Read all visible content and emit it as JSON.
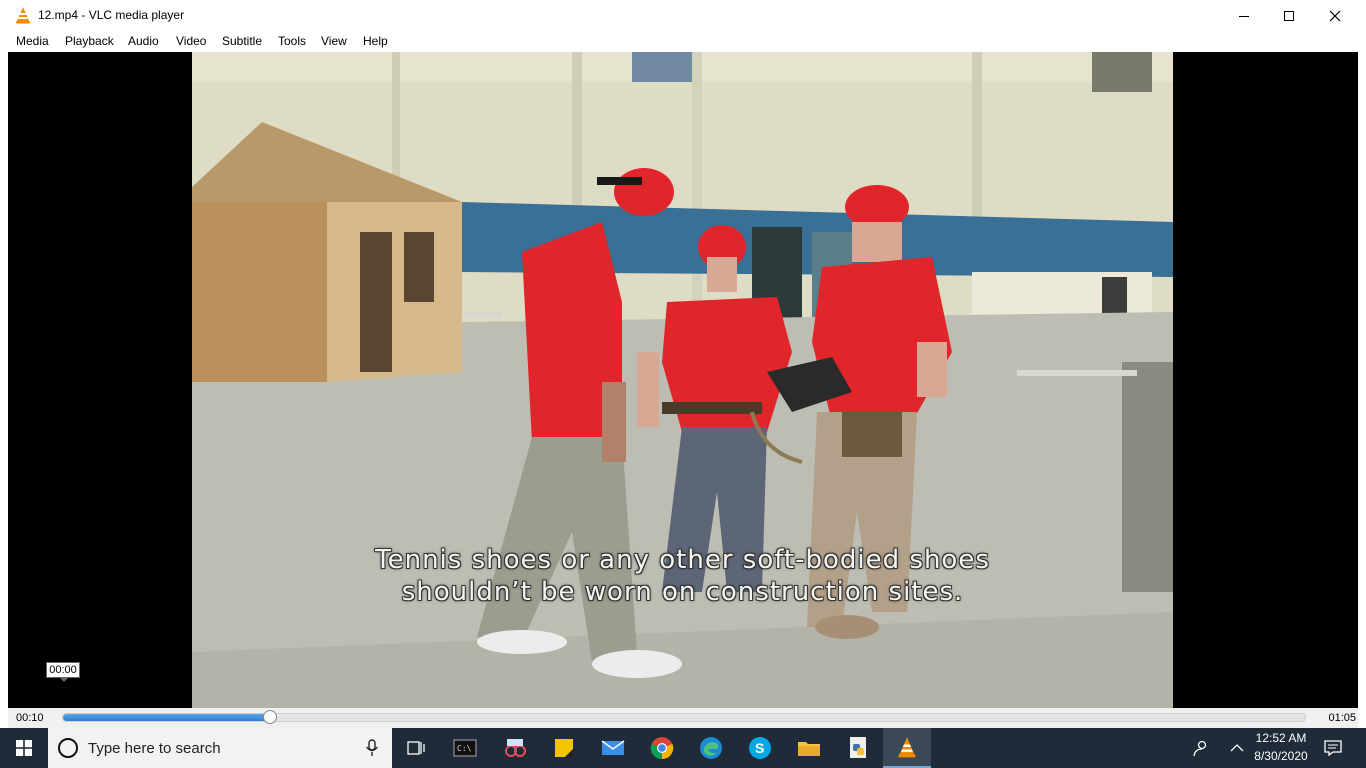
{
  "window": {
    "title": "12.mp4 - VLC media player"
  },
  "menu": [
    "Media",
    "Playback",
    "Audio",
    "Video",
    "Subtitle",
    "Tools",
    "View",
    "Help"
  ],
  "video": {
    "subtitle_line1": "Tennis shoes or any other soft-bodied shoes",
    "subtitle_line2": "shouldn’t be worn on construction sites.",
    "hover_time": "00:00"
  },
  "seekbar": {
    "elapsed": "00:10",
    "total": "01:05",
    "progress": 0.1667
  },
  "taskbar": {
    "search_placeholder": "Type here to search",
    "clock_time": "12:52 AM",
    "clock_date": "8/30/2020"
  },
  "colors": {
    "accent": "#2d7fd2",
    "taskbar": "#1f2b38",
    "hardhat": "#e0262a"
  }
}
